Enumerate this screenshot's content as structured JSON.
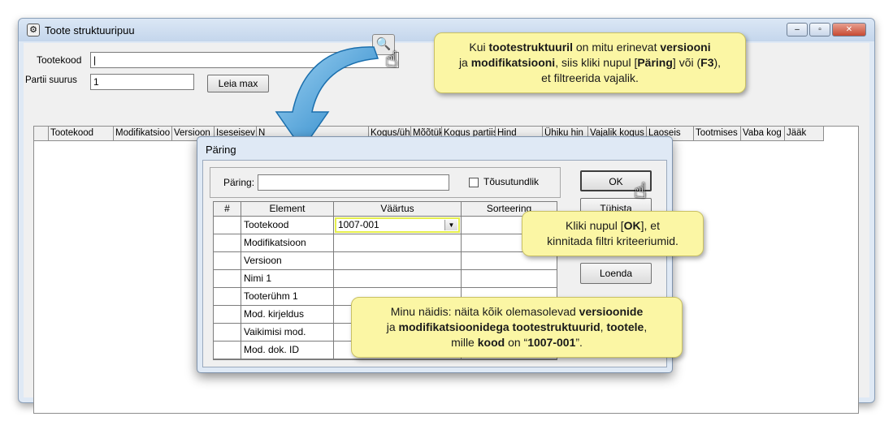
{
  "window": {
    "title": "Toote struktuuripuu",
    "min": "–",
    "max": "▫",
    "close": "✕"
  },
  "form": {
    "tootekood_label": "Tootekood",
    "tootekood_value": "|",
    "partii_label": "Partii suurus",
    "partii_value": "1",
    "leia_max_label": "Leia max"
  },
  "grid": {
    "columns": [
      "Tootekood",
      "Modifikatsioo",
      "Versioon",
      "Iseseisev",
      "N",
      "Kogus/üh",
      "Mõõtük",
      "Kogus partiis",
      "Hind",
      "Ühiku hin",
      "Vajalik kogus",
      "Laoseis",
      "Tootmises",
      "Vaba kog",
      "Jääk"
    ]
  },
  "dialog": {
    "title": "Päring",
    "paring_label": "Päring:",
    "paring_value": "",
    "tousutundlik_label": "Tõusutundlik",
    "headers": {
      "num": "#",
      "element": "Element",
      "vaartus": "Väärtus",
      "sorteering": "Sorteering"
    },
    "rows": [
      {
        "element": "Tootekood",
        "value": "1007-001"
      },
      {
        "element": "Modifikatsioon",
        "value": ""
      },
      {
        "element": "Versioon",
        "value": ""
      },
      {
        "element": "Nimi 1",
        "value": ""
      },
      {
        "element": "Tooterühm 1",
        "value": ""
      },
      {
        "element": "Mod. kirjeldus",
        "value": ""
      },
      {
        "element": "Vaikimisi mod.",
        "value": ""
      },
      {
        "element": "Mod. dok. ID",
        "value": ""
      }
    ],
    "ok_label": "OK",
    "tuhista_label": "Tühista",
    "loenda_label": "Loenda"
  },
  "callouts": {
    "top_1a": "Kui ",
    "top_1b": "tootestruktuuril",
    "top_1c": " on mitu erinevat ",
    "top_1d": "versiooni",
    "top_2a": "ja ",
    "top_2b": "modifikatsiooni",
    "top_2c": ", siis kliki nupul [",
    "top_2d": "Päring",
    "top_2e": "] või (",
    "top_2f": "F3",
    "top_2g": "),",
    "top_3": "et filtreerida vajalik.",
    "ok_1a": "Kliki nupul [",
    "ok_1b": "OK",
    "ok_1c": "], et",
    "ok_2": "kinnitada filtri kriteeriumid.",
    "ex_1a": "Minu näidis: näita kõik olemasolevad ",
    "ex_1b": "versioonide",
    "ex_2a": "ja ",
    "ex_2b": "modifikatsioonidega tootestruktuurid",
    "ex_2c": ", ",
    "ex_2d": "tootele",
    "ex_2e": ",",
    "ex_3a": "mille ",
    "ex_3b": "kood",
    "ex_3c": " on “",
    "ex_3d": "1007-001",
    "ex_3e": "”."
  }
}
